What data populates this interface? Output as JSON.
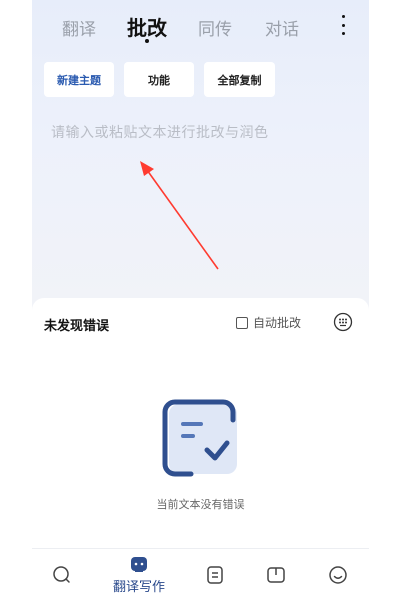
{
  "tabs": [
    {
      "label": "翻译"
    },
    {
      "label": "批改"
    },
    {
      "label": "同传"
    },
    {
      "label": "对话"
    }
  ],
  "actions": {
    "new_topic": "新建主题",
    "features": "功能",
    "copy_all": "全部复制"
  },
  "editor": {
    "placeholder": "请输入或粘贴文本进行批改与润色"
  },
  "result_panel": {
    "title": "未发现错误",
    "auto_correct_label": "自动批改",
    "auto_correct_checked": false,
    "empty_message": "当前文本没有错误"
  },
  "bottom_nav": {
    "active_label": "翻译写作",
    "items": [
      "search-icon",
      "translate-write-icon",
      "document-icon",
      "book-icon",
      "smile-icon"
    ]
  },
  "colors": {
    "accent": "#2b5bb0",
    "arrow": "#ff3b30",
    "icon_blue": "#2f4f8f"
  }
}
